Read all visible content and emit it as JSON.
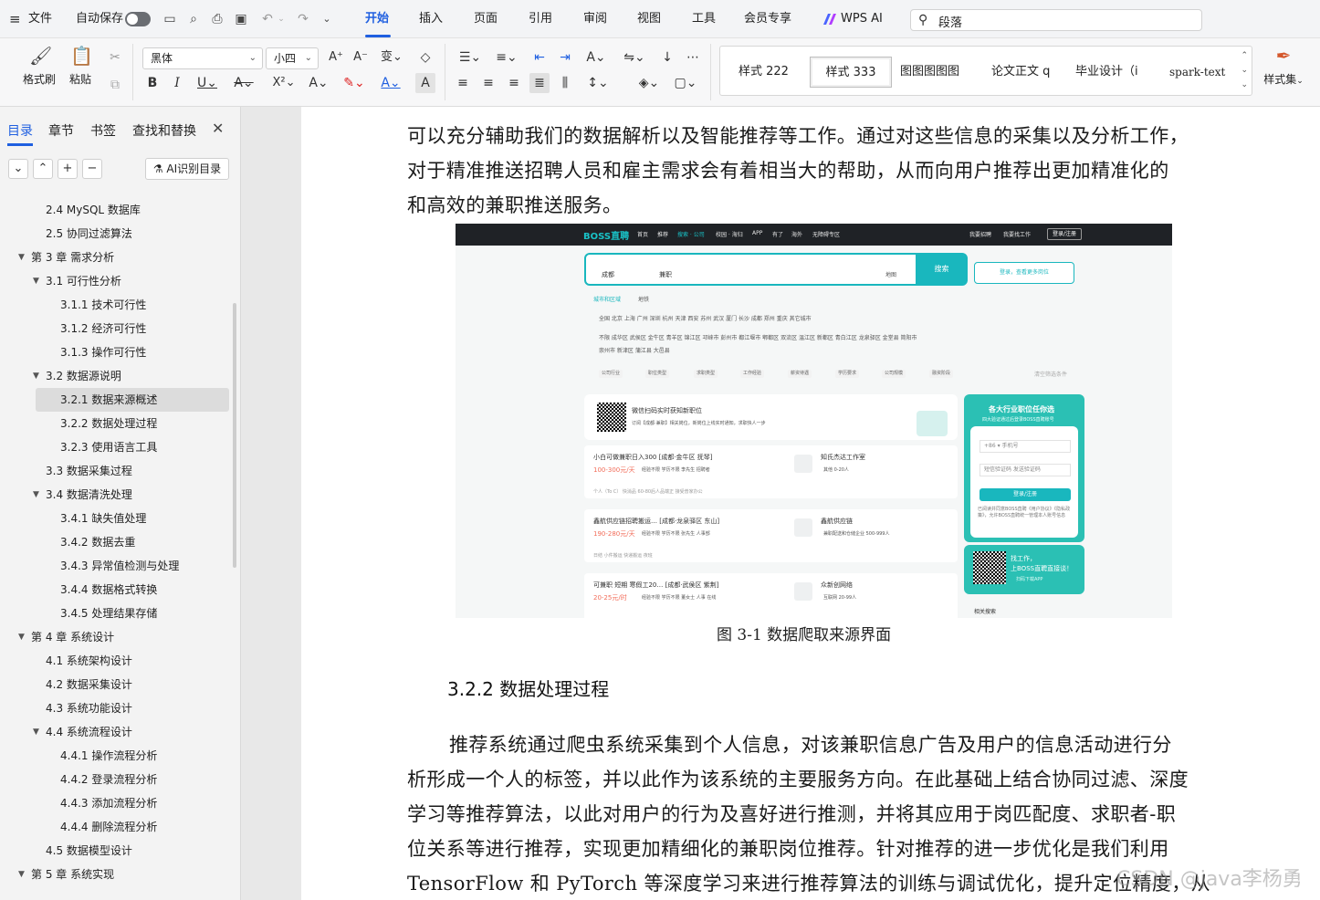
{
  "menubar": {
    "file_label": "文件",
    "autosave_label": "自动保存",
    "tabs": [
      "开始",
      "插入",
      "页面",
      "引用",
      "审阅",
      "视图",
      "工具",
      "会员专享"
    ],
    "wps_ai_label": "WPS AI",
    "search_text": "段落"
  },
  "ribbon": {
    "format_painter_label": "格式刷",
    "paste_label": "粘贴",
    "font_name": "黑体",
    "font_size": "小四",
    "styles": [
      "样式 222",
      "样式 333",
      "图图图图图",
      "论文正文 q",
      "毕业设计（i",
      "spark-text"
    ],
    "style_set_label": "样式集"
  },
  "nav": {
    "tabs": [
      "目录",
      "章节",
      "书签",
      "查找和替换"
    ],
    "ai_toc_label": "AI识别目录",
    "items": [
      {
        "label": "2.4 MySQL 数据库",
        "level": 2,
        "expand": ""
      },
      {
        "label": "2.5 协同过滤算法",
        "level": 2,
        "expand": ""
      },
      {
        "label": "第 3 章 需求分析",
        "level": 1,
        "expand": "▼"
      },
      {
        "label": "3.1 可行性分析",
        "level": 2,
        "expand": "▼"
      },
      {
        "label": "3.1.1 技术可行性",
        "level": 3,
        "expand": ""
      },
      {
        "label": "3.1.2 经济可行性",
        "level": 3,
        "expand": ""
      },
      {
        "label": "3.1.3 操作可行性",
        "level": 3,
        "expand": ""
      },
      {
        "label": "3.2 数据源说明",
        "level": 2,
        "expand": "▼"
      },
      {
        "label": "3.2.1 数据来源概述",
        "level": 3,
        "expand": "",
        "active": true
      },
      {
        "label": "3.2.2 数据处理过程",
        "level": 3,
        "expand": ""
      },
      {
        "label": "3.2.3 使用语言工具",
        "level": 3,
        "expand": ""
      },
      {
        "label": "3.3 数据采集过程",
        "level": 2,
        "expand": ""
      },
      {
        "label": "3.4 数据清洗处理",
        "level": 2,
        "expand": "▼"
      },
      {
        "label": "3.4.1 缺失值处理",
        "level": 3,
        "expand": ""
      },
      {
        "label": "3.4.2 数据去重",
        "level": 3,
        "expand": ""
      },
      {
        "label": "3.4.3 异常值检测与处理",
        "level": 3,
        "expand": ""
      },
      {
        "label": "3.4.4 数据格式转换",
        "level": 3,
        "expand": ""
      },
      {
        "label": "3.4.5 处理结果存储",
        "level": 3,
        "expand": ""
      },
      {
        "label": "第 4 章 系统设计",
        "level": 1,
        "expand": "▼"
      },
      {
        "label": "4.1 系统架构设计",
        "level": 2,
        "expand": ""
      },
      {
        "label": "4.2 数据采集设计",
        "level": 2,
        "expand": ""
      },
      {
        "label": "4.3 系统功能设计",
        "level": 2,
        "expand": ""
      },
      {
        "label": "4.4 系统流程设计",
        "level": 2,
        "expand": "▼"
      },
      {
        "label": "4.4.1 操作流程分析",
        "level": 3,
        "expand": ""
      },
      {
        "label": "4.4.2 登录流程分析",
        "level": 3,
        "expand": ""
      },
      {
        "label": "4.4.3 添加流程分析",
        "level": 3,
        "expand": ""
      },
      {
        "label": "4.4.4 删除流程分析",
        "level": 3,
        "expand": ""
      },
      {
        "label": "4.5 数据模型设计",
        "level": 2,
        "expand": ""
      },
      {
        "label": "第 5 章 系统实现",
        "level": 1,
        "expand": "▼"
      }
    ]
  },
  "document": {
    "para1": [
      "可以充分辅助我们的数据解析以及智能推荐等工作。通过对这些信息的采集以及分析工作，",
      "对于精准推送招聘人员和雇主需求会有着相当大的帮助，从而向用户推荐出更加精准化的",
      "和高效的兼职推送服务。"
    ],
    "figure_caption": "图 3-1  数据爬取来源界面",
    "section_heading": "3.2.2  数据处理过程",
    "para2": [
      "推荐系统通过爬虫系统采集到个人信息，对该兼职信息广告及用户的信息活动进行分",
      "析形成一个人的标签，并以此作为该系统的主要服务方向。在此基础上结合协同过滤、深度",
      "学习等推荐算法，以此对用户的行为及喜好进行推测，并将其应用于岗匹配度、求职者-职",
      "位关系等进行推荐，实现更加精细化的兼职岗位推荐。针对推荐的进一步优化是我们利用",
      "TensorFlow 和 PyTorch 等深度学习来进行推荐算法的训练与调试优化，提升定位精度，从"
    ],
    "watermark": "CSDN @java李杨勇"
  },
  "figure": {
    "logo": "BOSS直聘",
    "nav_items": [
      "首页",
      "推荐",
      "搜索 · 公司",
      "校园 · 海归",
      "APP",
      "有了",
      "海外",
      "无障碍专区"
    ],
    "right_links": [
      "我要招聘",
      "我要找工作"
    ],
    "register": "登录/注册",
    "city": "成都",
    "keyword": "兼职",
    "map": "地图",
    "search_btn": "搜索",
    "login_hint": "登录，查看更多岗位",
    "area_tabs": [
      "城市和区域",
      "地铁"
    ],
    "cities": "全国  北京  上海  广州  深圳  杭州  天津  西安  苏州  武汉  厦门  长沙  成都  郑州  重庆  其它城市",
    "districts1": "不限  成华区  武侯区  金牛区  青羊区  锦江区  邛崃市  彭州市  都江堰市  郫都区  双流区  温江区  新都区  青白江区  龙泉驿区  金堂县  简阳市",
    "districts2": "崇州市  新津区  蒲江县  大邑县",
    "filters": [
      "公司行业",
      "职位类型",
      "求职类型",
      "工作经验",
      "薪资待遇",
      "学历要求",
      "公司规模",
      "融资阶段"
    ],
    "clear_filters": "清空筛选条件",
    "qr_title": "微信扫码实时获知新职位",
    "qr_desc": "订阅【成都·兼职】相关岗位，新岗位上线实时通知，求职快人一步",
    "jobs": [
      {
        "title": "小白可做兼职日入300  [成都·金牛区 抚琴]",
        "salary": "100-300元/天",
        "tags": "经验不限  学历不限  李先生 招聘者",
        "company": "知氏杰达工作室",
        "info": "其他  0-20人",
        "foot": "个人（To C）  快消品  60-80后人品端正  接受普家办公"
      },
      {
        "title": "鑫航供应链招聘搬运…  [成都·龙泉驿区 东山]",
        "salary": "190-280元/天",
        "tags": "经验不限  学历不限  张先生 人事部",
        "company": "鑫航供应链",
        "info": "兼职配送和仓储企业  500-999人",
        "foot": "日结  小件搬运  快递搬运  夜班"
      },
      {
        "title": "可兼职 短期 寒假工20…  [成都·武侯区 紫荆]",
        "salary": "20-25元/时",
        "tags": "经验不限  学历不限  董女士 人事  在线",
        "company": "众新创网络",
        "info": "互联网  20-99人",
        "foot": ""
      }
    ],
    "side_title": "各大行业职位任你选",
    "side_sub": "四大验证通过后登录BOSS直聘账号",
    "phone_hint": "+86 ▾  手机号",
    "code_hint": "短信验证码     发送验证码",
    "login_btn": "登录/注册",
    "agree": "已阅读并同意BOSS直聘《用户协议》《隐私政策》，允许BOSS直聘统一管理本人账号信息",
    "app_line1": "找工作，",
    "app_line2": "上BOSS直聘直接谈！",
    "app_dl": "扫码下载APP",
    "related": "相关搜索"
  }
}
